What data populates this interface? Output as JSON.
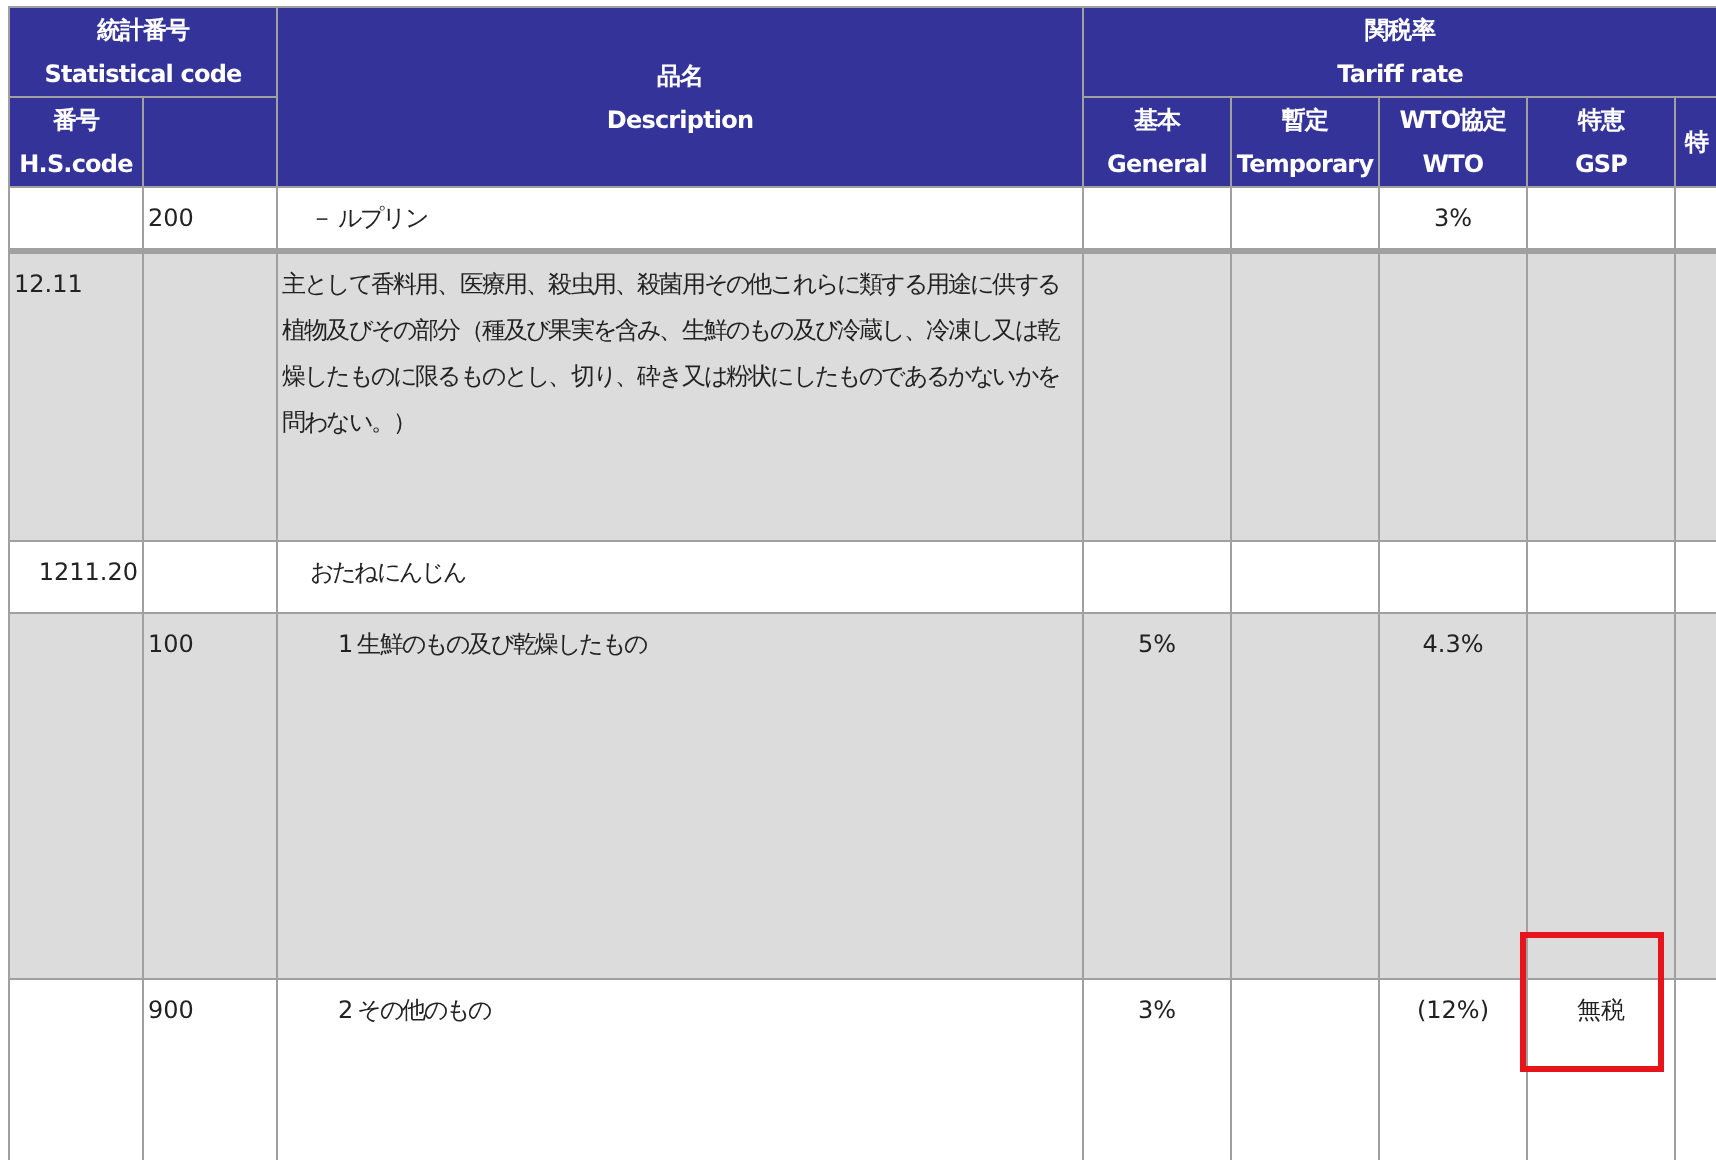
{
  "header": {
    "statistical_code": [
      "統計番号",
      "Statistical code"
    ],
    "hs_code": [
      "番号",
      "H.S.code"
    ],
    "description": [
      "品名",
      "Description"
    ],
    "tariff_rate": [
      "関税率",
      "Tariff rate"
    ],
    "rate_columns": [
      [
        "基本",
        "General"
      ],
      [
        "暫定",
        "Temporary"
      ],
      [
        "WTO協定",
        "WTO"
      ],
      [
        "特恵",
        "GSP"
      ],
      [
        "特"
      ]
    ]
  },
  "rows": [
    {
      "kind": "subheading",
      "shaded": false,
      "sub_code": "200",
      "description": "－ ルプリン",
      "rates": {
        "wto": {
          "value": "3%",
          "highlighted": false
        }
      }
    },
    {
      "kind": "heading",
      "shaded": true,
      "hs_code": "12.11",
      "description": "主として香料用、医療用、殺虫用、殺菌用その他これらに類する用途に供する植物及びその部分（種及び果実を含み、生鮮のもの及び冷蔵し、冷凍し又は乾燥したものに限るものとし、切り、砕き又は粉状にしたものであるかないかを問わない。）",
      "rates": {}
    },
    {
      "kind": "subheading",
      "shaded": false,
      "hs_code": "1211.20",
      "description": "おたねにんじん",
      "rates": {}
    },
    {
      "kind": "item",
      "shaded": true,
      "sub_code": "100",
      "description": "1 生鮮のもの及び乾燥したもの",
      "rates": {
        "general": {
          "value": "5%",
          "highlighted": false
        },
        "wto": {
          "value": "4.3%",
          "highlighted": false
        }
      }
    },
    {
      "kind": "item",
      "shaded": false,
      "sub_code": "900",
      "description": "2 その他のもの",
      "rates": {
        "general": {
          "value": "3%",
          "highlighted": false
        },
        "wto": {
          "value": "(12%)",
          "highlighted": false
        },
        "gsp": {
          "value": "無税",
          "highlighted": true
        }
      }
    }
  ]
}
